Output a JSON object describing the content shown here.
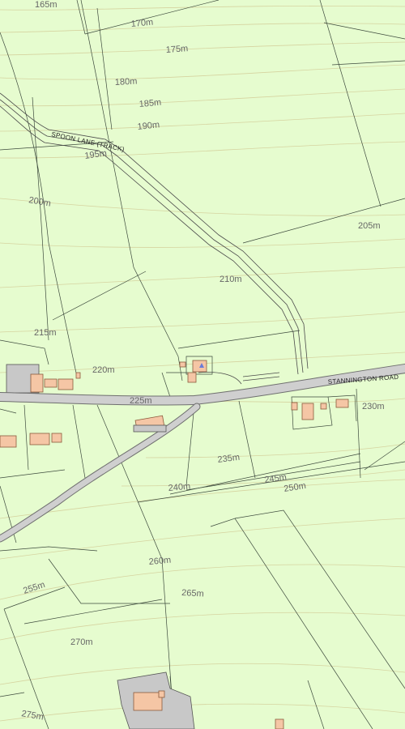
{
  "map": {
    "contour_labels": [
      {
        "id": "c165",
        "text": "165m"
      },
      {
        "id": "c170",
        "text": "170m"
      },
      {
        "id": "c175",
        "text": "175m"
      },
      {
        "id": "c180",
        "text": "180m"
      },
      {
        "id": "c185",
        "text": "185m"
      },
      {
        "id": "c190",
        "text": "190m"
      },
      {
        "id": "c195",
        "text": "195m"
      },
      {
        "id": "c200",
        "text": "200m"
      },
      {
        "id": "c205",
        "text": "205m"
      },
      {
        "id": "c210",
        "text": "210m"
      },
      {
        "id": "c215",
        "text": "215m"
      },
      {
        "id": "c220",
        "text": "220m"
      },
      {
        "id": "c225",
        "text": "225m"
      },
      {
        "id": "c230",
        "text": "230m"
      },
      {
        "id": "c235",
        "text": "235m"
      },
      {
        "id": "c240",
        "text": "240m"
      },
      {
        "id": "c245",
        "text": "245m"
      },
      {
        "id": "c250",
        "text": "250m"
      },
      {
        "id": "c255",
        "text": "255m"
      },
      {
        "id": "c260",
        "text": "260m"
      },
      {
        "id": "c265",
        "text": "265m"
      },
      {
        "id": "c270",
        "text": "270m"
      },
      {
        "id": "c275",
        "text": "275m"
      }
    ],
    "road_labels": {
      "spoon_lane": "SPOON LANE (TRACK)",
      "stannington_road": "STANNINGTON ROAD"
    },
    "colors": {
      "land": "#e6fccf",
      "building": "#f5c6a5",
      "road": "#cfcfcf",
      "contour": "#c9b27a"
    }
  }
}
